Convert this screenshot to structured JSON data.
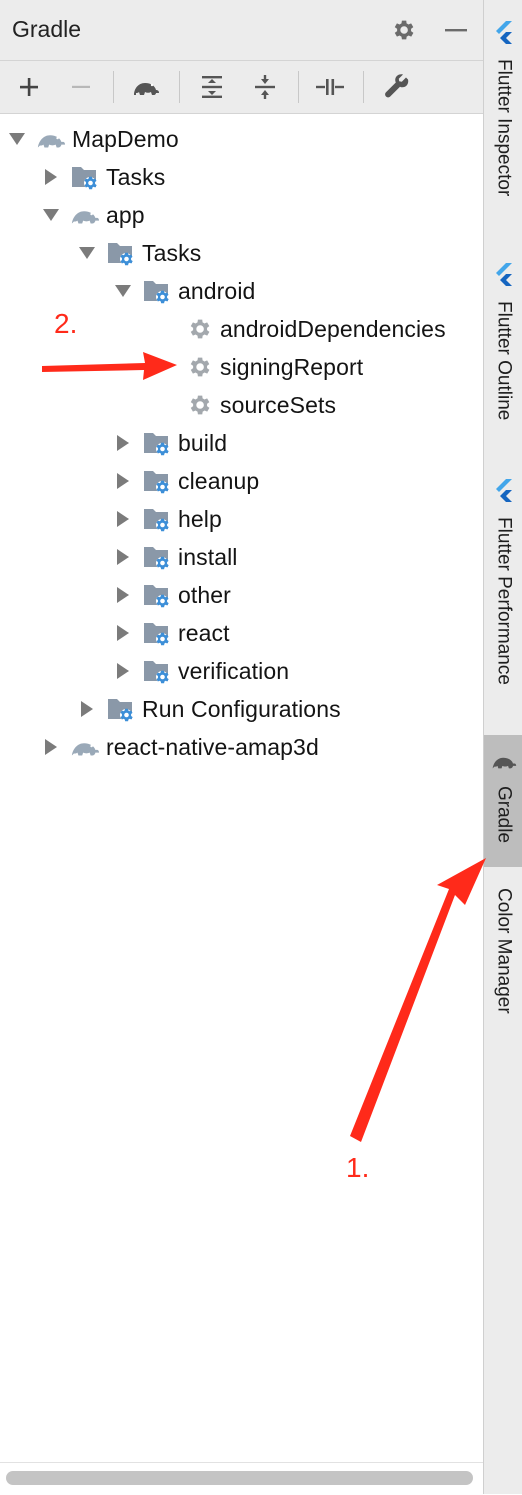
{
  "panel": {
    "title": "Gradle",
    "settings_icon": "gear-icon",
    "hide_icon": "minimize-icon"
  },
  "toolbar": {
    "items": [
      "plus-icon",
      "minus-icon",
      "elephant-icon",
      "expand-all-icon",
      "collapse-all-icon",
      "toggle-offline-icon",
      "wrench-icon"
    ]
  },
  "tree": {
    "root": "MapDemo",
    "root_tasks": "Tasks",
    "app": "app",
    "app_tasks": "Tasks",
    "android": "android",
    "android_children": [
      "androidDependencies",
      "signingReport",
      "sourceSets"
    ],
    "groups": [
      "build",
      "cleanup",
      "help",
      "install",
      "other",
      "react",
      "verification"
    ],
    "run_configurations": "Run Configurations",
    "second_project": "react-native-amap3d"
  },
  "side_tabs": {
    "flutter_inspector": "Flutter Inspector",
    "flutter_outline": "Flutter Outline",
    "flutter_performance": "Flutter Performance",
    "gradle": "Gradle",
    "color_manager": "Color Manager"
  },
  "annotations": {
    "step1": "1.",
    "step2": "2."
  },
  "colors": {
    "annotation": "#ff2a1a",
    "folder": "#8a98a8",
    "gear": "#3d8fd8",
    "active_tab": "#bdbdbd"
  }
}
